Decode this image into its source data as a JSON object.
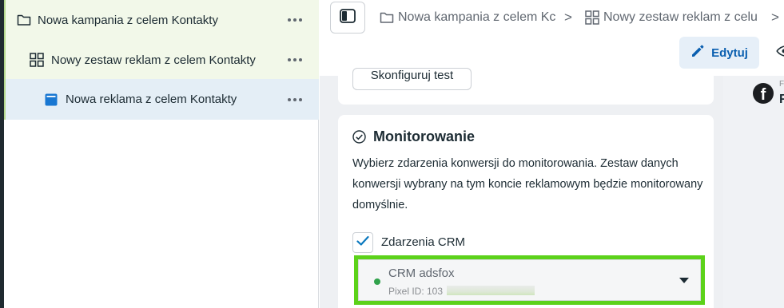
{
  "tree": {
    "items": [
      {
        "label": "Nowa kampania z celem Kontakty",
        "icon": "folder-icon"
      },
      {
        "label": "Nowy zestaw reklam z celem Kontakty",
        "icon": "ad-set-grid-icon"
      },
      {
        "label": "Nowa reklama z celem Kontakty",
        "icon": "ad-icon"
      }
    ]
  },
  "header": {
    "breadcrumbs": [
      {
        "label": "Nowa kampania z celem Kc",
        "icon": "folder-icon"
      },
      {
        "label": "Nowy zestaw reklam z celu",
        "icon": "ad-set-grid-icon"
      }
    ],
    "separator": ">",
    "edit_label": "Edytuj"
  },
  "settings": {
    "config_test_label": "Skonfiguruj test"
  },
  "monitoring": {
    "title": "Monitorowanie",
    "description": "Wybierz zdarzenia konwersji do monitorowania. Zestaw danych konwersji wybrany na tym koncie reklamowym będzie monitorowany domyślnie.",
    "crm_checkbox_label": "Zdarzenia CRM",
    "crm_checked": true,
    "pixel_name": "CRM adsfox",
    "pixel_id_prefix": "Pixel ID: 103",
    "pixel_status_color": "#31a24c"
  },
  "preview": {
    "brand_letter": "f",
    "small_text": "F",
    "big_text": "F"
  },
  "colors": {
    "accent": "#0a5fb0",
    "highlight": "#5cd21a",
    "tree_selected": "#e4eef6",
    "tree_parent": "#f2f8e9"
  }
}
